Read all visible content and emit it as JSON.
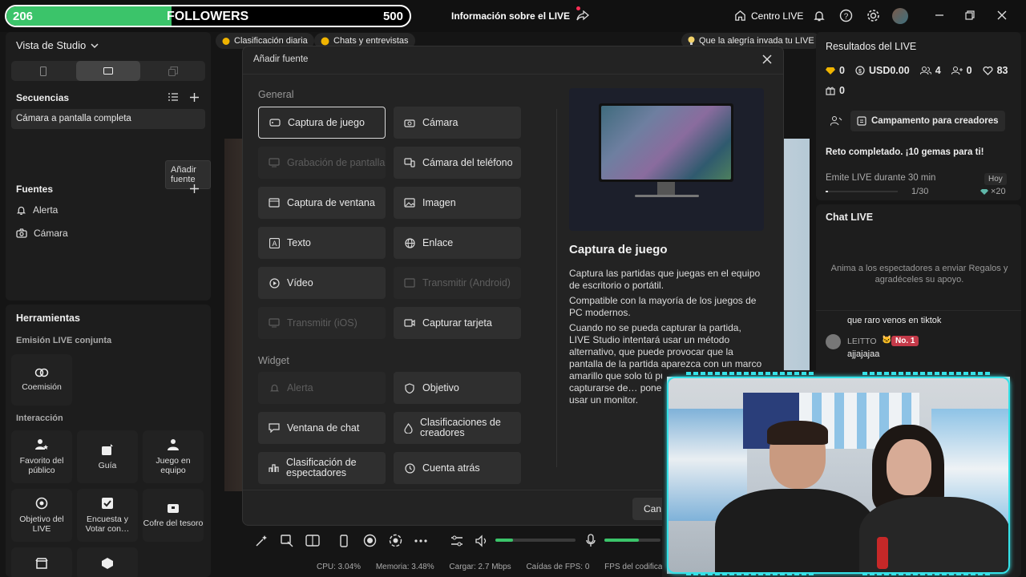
{
  "topbar": {
    "followers_current": "206",
    "followers_label": "FOLLOWERS",
    "followers_goal": "500",
    "followers_progress_fraction": 0.41,
    "live_info": "Información sobre el LIVE",
    "centro_live": "Centro LIVE"
  },
  "studio": {
    "view_label": "Vista de Studio",
    "sequences_title": "Secuencias",
    "sequence_item": "Cámara a pantalla completa",
    "tooltip_add_source": "Añadir fuente",
    "sources_title": "Fuentes",
    "sources": [
      "Alerta",
      "Cámara"
    ]
  },
  "tools": {
    "title": "Herramientas",
    "joint_title": "Emisión LIVE conjunta",
    "coemision": "Coemisión",
    "interaction_title": "Interacción",
    "items": [
      "Favorito del público",
      "Guía",
      "Juego en equipo",
      "Objetivo del LIVE",
      "Encuesta y Votar con…",
      "Cofre del tesoro"
    ]
  },
  "banners": {
    "clasificacion": "Clasificación diaria",
    "chats": "Chats y entrevistas",
    "alegria": "Que la alegría invada tu LIVE"
  },
  "modal": {
    "title": "Añadir fuente",
    "general_title": "General",
    "widget_title": "Widget",
    "options": {
      "captura_juego": "Captura de juego",
      "camara": "Cámara",
      "grabacion_pantalla": "Grabación de pantalla",
      "camara_telefono": "Cámara del teléfono",
      "captura_ventana": "Captura de ventana",
      "imagen": "Imagen",
      "texto": "Texto",
      "enlace": "Enlace",
      "video": "Vídeo",
      "transmitir_android": "Transmitir (Android)",
      "transmitir_ios": "Transmitir (iOS)",
      "capturar_tarjeta": "Capturar tarjeta",
      "alerta": "Alerta",
      "objetivo": "Objetivo",
      "ventana_chat": "Ventana de chat",
      "clasificaciones_creadores": "Clasificaciones de creadores",
      "clasificacion_espectadores": "Clasificación de espectadores",
      "cuenta_atras": "Cuenta atrás"
    },
    "detail_title": "Captura de juego",
    "detail_p1": "Captura las partidas que juegas en el equipo de escritorio o portátil.",
    "detail_p2": "Compatible con la mayoría de los juegos de PC modernos.",
    "detail_p3": "Cuando no se pueda capturar la partida, LIVE Studio intentará usar un método alternativo, que puede provocar que la pantalla de la partida aparezca con un marco amarillo que solo tú puedes ver. Si l… puede capturarse de… poner el juego en mo… y a usar un monitor.",
    "cancel_label": "Can"
  },
  "results": {
    "title": "Resultados del LIVE",
    "diamonds": "0",
    "usd": "USD0.00",
    "viewers": "4",
    "new_followers": "0",
    "likes": "83",
    "gifts": "0",
    "bootcamp": "Campamento para creadores",
    "challenge_title": "Reto completado. ¡10 gemas para ti!",
    "challenge_task": "Emite LIVE durante 30 min",
    "challenge_badge": "Hoy",
    "challenge_progress": "1/30",
    "challenge_reward": "×20"
  },
  "chat": {
    "title": "Chat LIVE",
    "prompt": "Anima a los espectadores a enviar Regalos y agradéceles su apoyo.",
    "msg1_text": "que raro venos en tiktok",
    "msg2_user": "LEITTO",
    "msg2_badge": "No. 1",
    "msg2_text": "ajjajajaa"
  },
  "statusbar": {
    "cpu": "CPU: 3.04%",
    "mem": "Memoria: 3.48%",
    "upload": "Cargar: 2.7 Mbps",
    "fps_drop": "Caídas de FPS: 0",
    "encoder_fps": "FPS del codificador:"
  },
  "colors": {
    "accent_green": "#3bc46a",
    "cyan_frame": "#35e2e8",
    "background": "#151515"
  }
}
